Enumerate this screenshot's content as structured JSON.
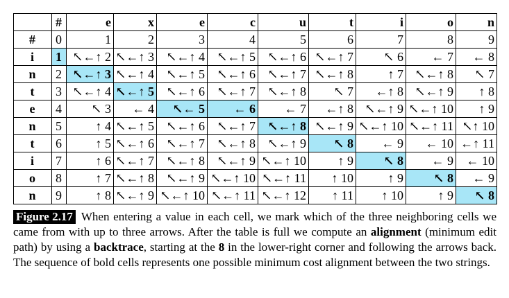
{
  "table": {
    "corner": "",
    "header": [
      "#",
      "e",
      "x",
      "e",
      "c",
      "u",
      "t",
      "i",
      "o",
      "n"
    ],
    "rows": [
      {
        "label": "#",
        "cells": [
          "0",
          "1",
          "2",
          "3",
          "4",
          "5",
          "6",
          "7",
          "8",
          "9"
        ]
      },
      {
        "label": "i",
        "cells": [
          "1",
          "↖←↑ 2",
          "↖←↑ 3",
          "↖←↑ 4",
          "↖←↑ 5",
          "↖←↑ 6",
          "↖←↑ 7",
          "↖ 6",
          "← 7",
          "← 8"
        ]
      },
      {
        "label": "n",
        "cells": [
          "2",
          "↖←↑ 3",
          "↖←↑ 4",
          "↖←↑ 5",
          "↖←↑ 6",
          "↖←↑ 7",
          "↖←↑ 8",
          "↑ 7",
          "↖←↑ 8",
          "↖ 7"
        ]
      },
      {
        "label": "t",
        "cells": [
          "3",
          "↖←↑ 4",
          "↖←↑ 5",
          "↖←↑ 6",
          "↖←↑ 7",
          "↖←↑ 8",
          "↖ 7",
          "←↑ 8",
          "↖←↑ 9",
          "↑ 8"
        ]
      },
      {
        "label": "e",
        "cells": [
          "4",
          "↖ 3",
          "← 4",
          "↖← 5",
          "← 6",
          "← 7",
          "←↑ 8",
          "↖←↑ 9",
          "↖←↑ 10",
          "↑ 9"
        ]
      },
      {
        "label": "n",
        "cells": [
          "5",
          "↑ 4",
          "↖←↑ 5",
          "↖←↑ 6",
          "↖←↑ 7",
          "↖←↑ 8",
          "↖←↑ 9",
          "↖←↑ 10",
          "↖←↑ 11",
          "↖↑ 10"
        ]
      },
      {
        "label": "t",
        "cells": [
          "6",
          "↑ 5",
          "↖←↑ 6",
          "↖←↑ 7",
          "↖←↑ 8",
          "↖←↑ 9",
          "↖ 8",
          "← 9",
          "← 10",
          "←↑ 11"
        ]
      },
      {
        "label": "i",
        "cells": [
          "7",
          "↑ 6",
          "↖←↑ 7",
          "↖←↑ 8",
          "↖←↑ 9",
          "↖←↑ 10",
          "↑ 9",
          "↖ 8",
          "← 9",
          "← 10"
        ]
      },
      {
        "label": "o",
        "cells": [
          "8",
          "↑ 7",
          "↖←↑ 8",
          "↖←↑ 9",
          "↖←↑ 10",
          "↖←↑ 11",
          "↑ 10",
          "↑ 9",
          "↖ 8",
          "← 9"
        ]
      },
      {
        "label": "n",
        "cells": [
          "9",
          "↑ 8",
          "↖←↑ 9",
          "↖←↑ 10",
          "↖←↑ 11",
          "↖←↑ 12",
          "↑ 11",
          "↑ 10",
          "↑ 9",
          "↖ 8"
        ]
      }
    ],
    "path_cells": [
      [
        1,
        0
      ],
      [
        2,
        1
      ],
      [
        3,
        2
      ],
      [
        4,
        3
      ],
      [
        4,
        4
      ],
      [
        5,
        5
      ],
      [
        6,
        6
      ],
      [
        7,
        7
      ],
      [
        8,
        8
      ],
      [
        9,
        9
      ]
    ]
  },
  "caption": {
    "label": "Figure 2.17",
    "part1": "When entering a value in each cell, we mark which of the three neighboring cells we came from with up to three arrows. After the table is full we compute an ",
    "bold1": "alignment",
    "part2": " (minimum edit path) by using a ",
    "bold2": "backtrace",
    "part3": ", starting at the ",
    "bold3": "8",
    "part4": " in the lower-right corner and following the arrows back. The sequence of bold cells represents one possible minimum cost alignment between the two strings."
  },
  "colors": {
    "highlight": "#a8e6f7"
  }
}
